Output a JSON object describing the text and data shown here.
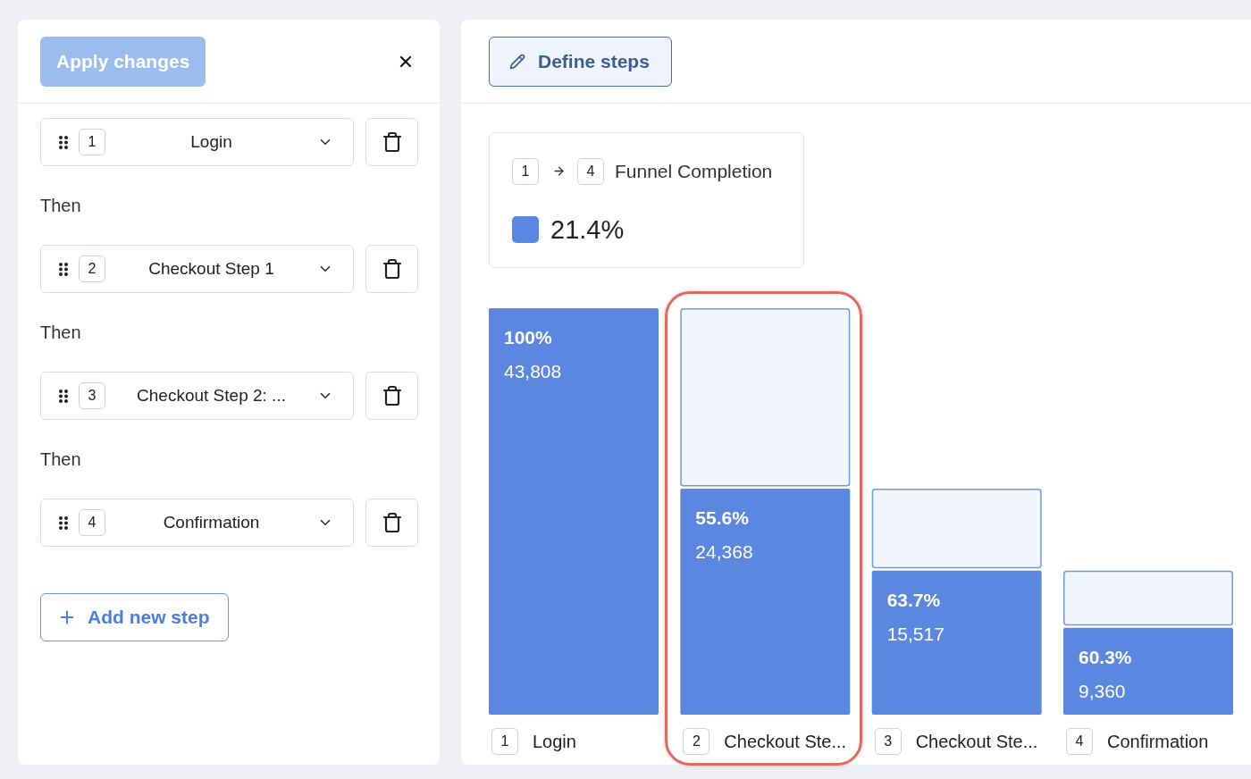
{
  "steps_panel": {
    "apply_button": {
      "label": "Apply changes",
      "disabled": true
    },
    "items": [
      {
        "kind": "step",
        "number": "1",
        "label": "Login"
      },
      {
        "kind": "separator",
        "label": "Then"
      },
      {
        "kind": "step",
        "number": "2",
        "label": "Checkout Step 1"
      },
      {
        "kind": "separator",
        "label": "Then"
      },
      {
        "kind": "step",
        "number": "3",
        "label": "Checkout Step 2: ..."
      },
      {
        "kind": "separator",
        "label": "Then"
      },
      {
        "kind": "step",
        "number": "4",
        "label": "Confirmation"
      }
    ],
    "add_button": {
      "label": "Add new step"
    }
  },
  "results_panel": {
    "define_button": {
      "label": "Define steps"
    },
    "summary": {
      "from": "1",
      "to": "4",
      "title": "Funnel Completion",
      "value": "21.4%"
    },
    "chart": {
      "chart_data": {
        "type": "bar",
        "stacked": true,
        "categories": [
          "Login",
          "Checkout Ste...",
          "Checkout Ste...",
          "Confirmation"
        ],
        "series": [
          {
            "color": "#5b87e0",
            "values": [
              43808,
              24368,
              15517,
              9360
            ],
            "value_labels": [
              "43,808",
              "24,368",
              "15,517",
              "9,360"
            ]
          },
          {
            "color": "#f1f5fc",
            "values": [
              0,
              19440,
              8851,
              6157
            ],
            "value_labels": [
              null,
              null,
              null,
              null
            ]
          }
        ]
      },
      "bars": [
        {
          "number": "1",
          "conversion": "100%",
          "highlighted": false
        },
        {
          "number": "2",
          "conversion": "55.6%",
          "highlighted": true
        },
        {
          "number": "3",
          "conversion": "63.7%",
          "highlighted": false
        },
        {
          "number": "4",
          "conversion": "60.3%",
          "highlighted": false
        }
      ]
    }
  }
}
